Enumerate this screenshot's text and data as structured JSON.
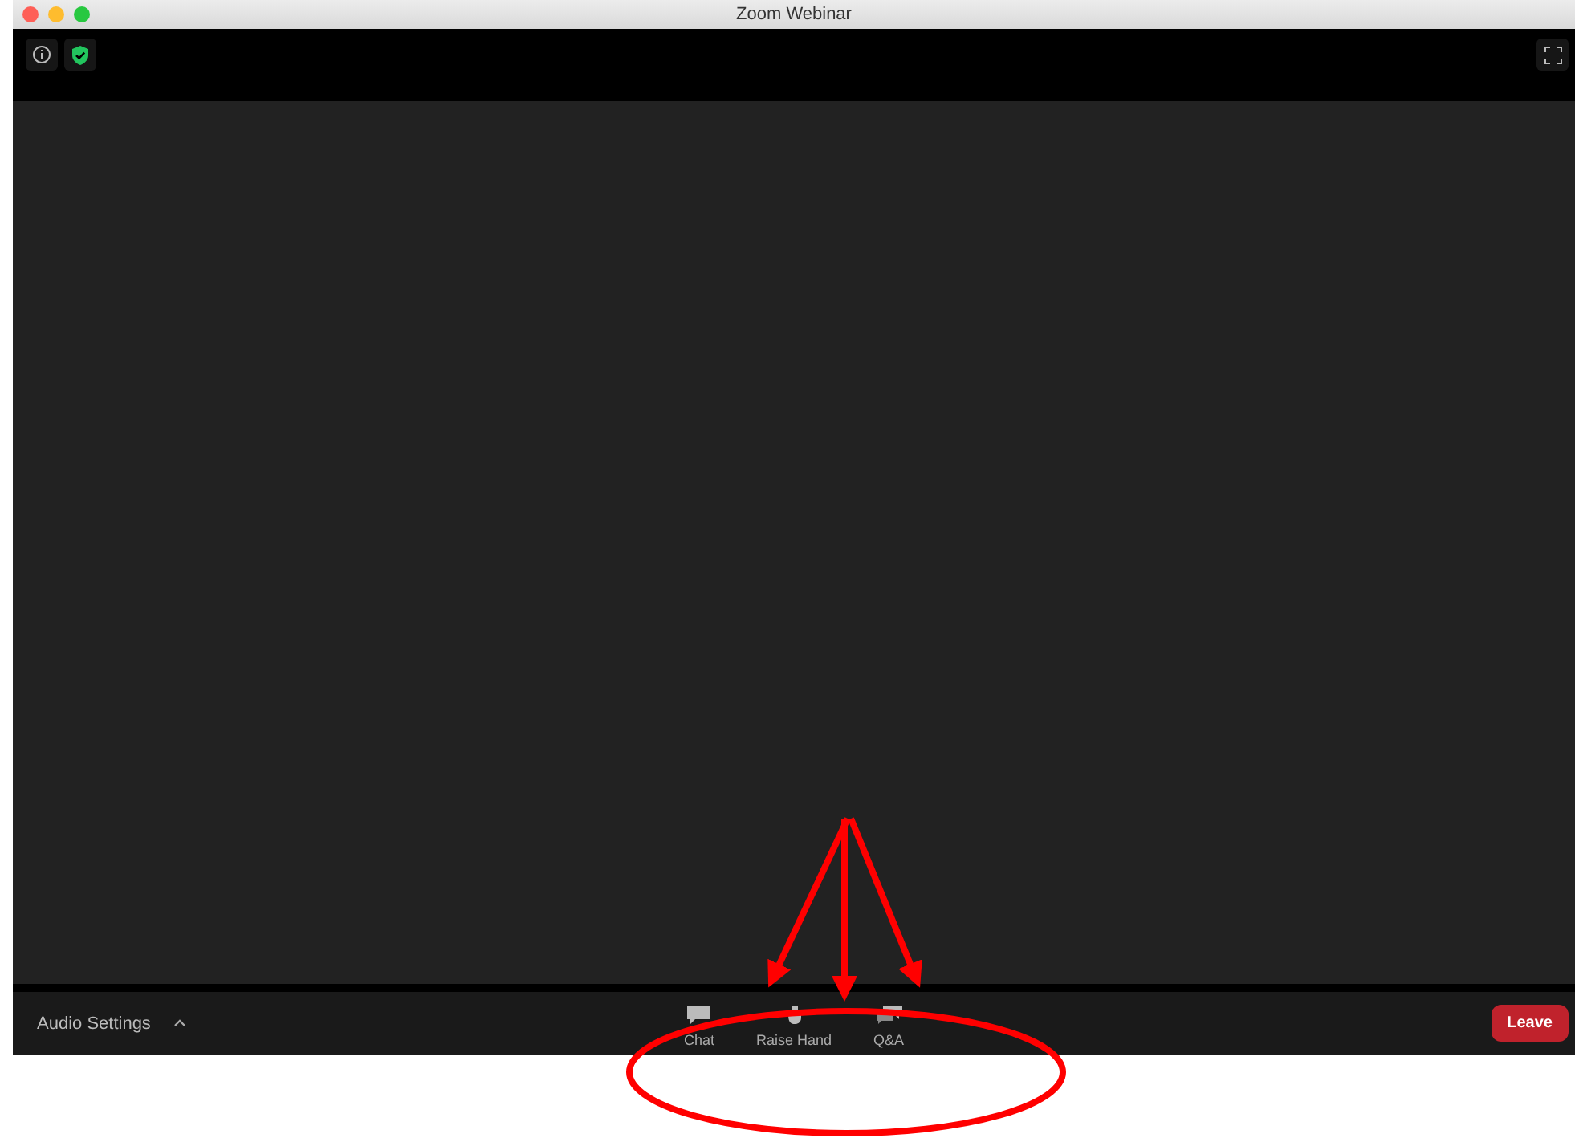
{
  "window": {
    "title": "Zoom Webinar"
  },
  "toolbar": {
    "audio_settings": "Audio Settings",
    "buttons": [
      {
        "kind": "chat",
        "label": "Chat"
      },
      {
        "kind": "hand",
        "label": "Raise Hand"
      },
      {
        "kind": "qa",
        "label": "Q&A"
      }
    ],
    "leave": "Leave"
  }
}
